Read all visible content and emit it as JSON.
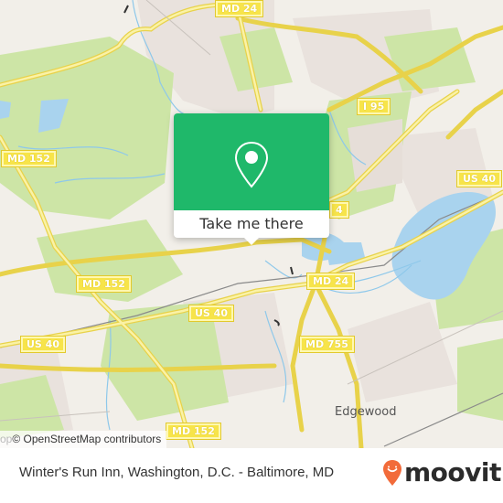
{
  "map": {
    "road_labels": [
      {
        "id": "md24-top",
        "text": "MD 24"
      },
      {
        "id": "i95",
        "text": "I 95"
      },
      {
        "id": "md152-left",
        "text": "MD 152"
      },
      {
        "id": "us40-right",
        "text": "US 40"
      },
      {
        "id": "md24-partial",
        "text": "4"
      },
      {
        "id": "md152-mid",
        "text": "MD 152"
      },
      {
        "id": "md24-mid",
        "text": "MD 24"
      },
      {
        "id": "us40-mid",
        "text": "US 40"
      },
      {
        "id": "us40-left",
        "text": "US 40"
      },
      {
        "id": "md755",
        "text": "MD 755"
      },
      {
        "id": "md152-bottom",
        "text": "MD 152"
      }
    ],
    "place_labels": [
      {
        "id": "edgewood",
        "text": "Edgewood"
      }
    ],
    "colors": {
      "land": "#f2efe9",
      "forest": "#cfe6a8",
      "water": "#a9d3ee",
      "road": "#f7e36a",
      "residential": "#e8e0dc"
    }
  },
  "popup": {
    "icon": "location-pin-icon",
    "button_label": "Take me there",
    "color": "#1fb86a"
  },
  "attribution": {
    "faint_prefix": "op",
    "text": "© OpenStreetMap contributors"
  },
  "footer": {
    "title": "Winter's Run Inn, Washington, D.C. - Baltimore, MD",
    "logo_text": "moovit",
    "logo_icon": "moovit-pin-icon",
    "logo_color": "#f26b3a"
  }
}
